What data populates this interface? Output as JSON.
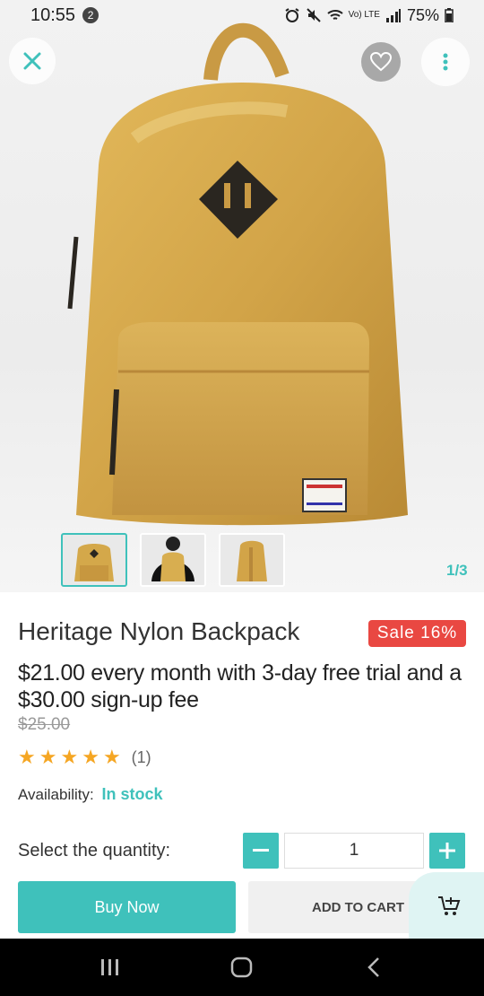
{
  "status_bar": {
    "time": "10:55",
    "notification_count": "2",
    "battery": "75%",
    "network": "Vo) LTE"
  },
  "gallery": {
    "counter": "1/3",
    "thumbnails": [
      "backpack-front",
      "backpack-model-back",
      "backpack-side"
    ]
  },
  "product": {
    "title": "Heritage Nylon Backpack",
    "sale_badge": "Sale 16%",
    "price_text": "$21.00 every month with 3-day free trial and a $30.00 sign-up fee",
    "old_price": "$25.00",
    "rating_stars": 5,
    "rating_count": "(1)",
    "availability_label": "Availability:",
    "availability_value": "In stock"
  },
  "quantity": {
    "label": "Select the quantity:",
    "value": "1"
  },
  "actions": {
    "buy_now": "Buy Now",
    "add_to_cart": "ADD TO CART"
  },
  "colors": {
    "accent": "#3fc1bb",
    "sale": "#e94842",
    "star": "#f5a623",
    "bag": "#d4a84a"
  }
}
